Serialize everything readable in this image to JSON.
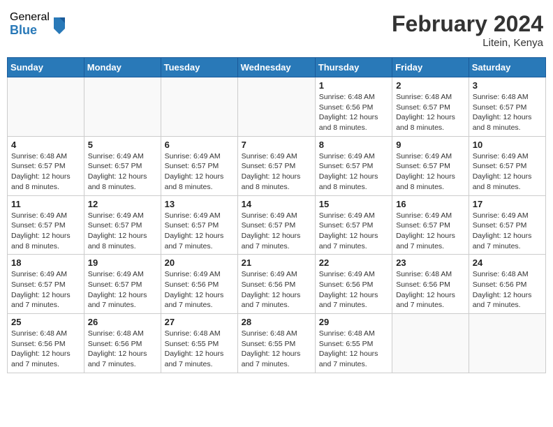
{
  "header": {
    "logo_general": "General",
    "logo_blue": "Blue",
    "month_year": "February 2024",
    "location": "Litein, Kenya"
  },
  "weekdays": [
    "Sunday",
    "Monday",
    "Tuesday",
    "Wednesday",
    "Thursday",
    "Friday",
    "Saturday"
  ],
  "weeks": [
    [
      {
        "day": "",
        "info": ""
      },
      {
        "day": "",
        "info": ""
      },
      {
        "day": "",
        "info": ""
      },
      {
        "day": "",
        "info": ""
      },
      {
        "day": "1",
        "info": "Sunrise: 6:48 AM\nSunset: 6:56 PM\nDaylight: 12 hours\nand 8 minutes."
      },
      {
        "day": "2",
        "info": "Sunrise: 6:48 AM\nSunset: 6:57 PM\nDaylight: 12 hours\nand 8 minutes."
      },
      {
        "day": "3",
        "info": "Sunrise: 6:48 AM\nSunset: 6:57 PM\nDaylight: 12 hours\nand 8 minutes."
      }
    ],
    [
      {
        "day": "4",
        "info": "Sunrise: 6:48 AM\nSunset: 6:57 PM\nDaylight: 12 hours\nand 8 minutes."
      },
      {
        "day": "5",
        "info": "Sunrise: 6:49 AM\nSunset: 6:57 PM\nDaylight: 12 hours\nand 8 minutes."
      },
      {
        "day": "6",
        "info": "Sunrise: 6:49 AM\nSunset: 6:57 PM\nDaylight: 12 hours\nand 8 minutes."
      },
      {
        "day": "7",
        "info": "Sunrise: 6:49 AM\nSunset: 6:57 PM\nDaylight: 12 hours\nand 8 minutes."
      },
      {
        "day": "8",
        "info": "Sunrise: 6:49 AM\nSunset: 6:57 PM\nDaylight: 12 hours\nand 8 minutes."
      },
      {
        "day": "9",
        "info": "Sunrise: 6:49 AM\nSunset: 6:57 PM\nDaylight: 12 hours\nand 8 minutes."
      },
      {
        "day": "10",
        "info": "Sunrise: 6:49 AM\nSunset: 6:57 PM\nDaylight: 12 hours\nand 8 minutes."
      }
    ],
    [
      {
        "day": "11",
        "info": "Sunrise: 6:49 AM\nSunset: 6:57 PM\nDaylight: 12 hours\nand 8 minutes."
      },
      {
        "day": "12",
        "info": "Sunrise: 6:49 AM\nSunset: 6:57 PM\nDaylight: 12 hours\nand 8 minutes."
      },
      {
        "day": "13",
        "info": "Sunrise: 6:49 AM\nSunset: 6:57 PM\nDaylight: 12 hours\nand 7 minutes."
      },
      {
        "day": "14",
        "info": "Sunrise: 6:49 AM\nSunset: 6:57 PM\nDaylight: 12 hours\nand 7 minutes."
      },
      {
        "day": "15",
        "info": "Sunrise: 6:49 AM\nSunset: 6:57 PM\nDaylight: 12 hours\nand 7 minutes."
      },
      {
        "day": "16",
        "info": "Sunrise: 6:49 AM\nSunset: 6:57 PM\nDaylight: 12 hours\nand 7 minutes."
      },
      {
        "day": "17",
        "info": "Sunrise: 6:49 AM\nSunset: 6:57 PM\nDaylight: 12 hours\nand 7 minutes."
      }
    ],
    [
      {
        "day": "18",
        "info": "Sunrise: 6:49 AM\nSunset: 6:57 PM\nDaylight: 12 hours\nand 7 minutes."
      },
      {
        "day": "19",
        "info": "Sunrise: 6:49 AM\nSunset: 6:57 PM\nDaylight: 12 hours\nand 7 minutes."
      },
      {
        "day": "20",
        "info": "Sunrise: 6:49 AM\nSunset: 6:56 PM\nDaylight: 12 hours\nand 7 minutes."
      },
      {
        "day": "21",
        "info": "Sunrise: 6:49 AM\nSunset: 6:56 PM\nDaylight: 12 hours\nand 7 minutes."
      },
      {
        "day": "22",
        "info": "Sunrise: 6:49 AM\nSunset: 6:56 PM\nDaylight: 12 hours\nand 7 minutes."
      },
      {
        "day": "23",
        "info": "Sunrise: 6:48 AM\nSunset: 6:56 PM\nDaylight: 12 hours\nand 7 minutes."
      },
      {
        "day": "24",
        "info": "Sunrise: 6:48 AM\nSunset: 6:56 PM\nDaylight: 12 hours\nand 7 minutes."
      }
    ],
    [
      {
        "day": "25",
        "info": "Sunrise: 6:48 AM\nSunset: 6:56 PM\nDaylight: 12 hours\nand 7 minutes."
      },
      {
        "day": "26",
        "info": "Sunrise: 6:48 AM\nSunset: 6:56 PM\nDaylight: 12 hours\nand 7 minutes."
      },
      {
        "day": "27",
        "info": "Sunrise: 6:48 AM\nSunset: 6:55 PM\nDaylight: 12 hours\nand 7 minutes."
      },
      {
        "day": "28",
        "info": "Sunrise: 6:48 AM\nSunset: 6:55 PM\nDaylight: 12 hours\nand 7 minutes."
      },
      {
        "day": "29",
        "info": "Sunrise: 6:48 AM\nSunset: 6:55 PM\nDaylight: 12 hours\nand 7 minutes."
      },
      {
        "day": "",
        "info": ""
      },
      {
        "day": "",
        "info": ""
      }
    ]
  ]
}
